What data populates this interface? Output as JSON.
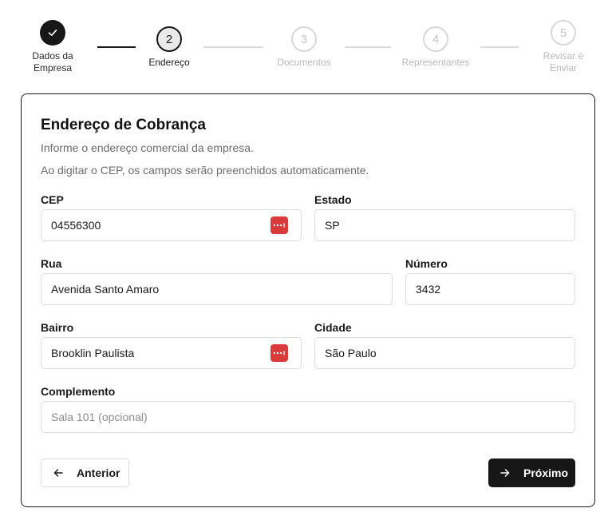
{
  "stepper": {
    "steps": [
      {
        "number": "",
        "label_line1": "Dados da",
        "label_line2": "Empresa",
        "state": "done"
      },
      {
        "number": "2",
        "label_line1": "Endereço",
        "label_line2": "",
        "state": "current"
      },
      {
        "number": "3",
        "label_line1": "Documentos",
        "label_line2": "",
        "state": "todo"
      },
      {
        "number": "4",
        "label_line1": "Representantes",
        "label_line2": "",
        "state": "todo"
      },
      {
        "number": "5",
        "label_line1": "Revisar e",
        "label_line2": "Enviar",
        "state": "todo"
      }
    ]
  },
  "card": {
    "title": "Endereço de Cobrança",
    "subtitle1": "Informe o endereço comercial da empresa.",
    "subtitle2": "Ao digitar o CEP, os campos serão preenchidos automaticamente."
  },
  "fields": {
    "cep": {
      "label": "CEP",
      "value": "04556300"
    },
    "estado": {
      "label": "Estado",
      "value": "SP"
    },
    "rua": {
      "label": "Rua",
      "value": "Avenida Santo Amaro"
    },
    "numero": {
      "label": "Número",
      "value": "3432"
    },
    "bairro": {
      "label": "Bairro",
      "value": "Brooklin Paulista"
    },
    "cidade": {
      "label": "Cidade",
      "value": "São Paulo"
    },
    "complemento": {
      "label": "Complemento",
      "placeholder": "Sala 101 (opcional)"
    }
  },
  "buttons": {
    "prev_label": "Anterior",
    "next_label": "Próximo"
  },
  "colors": {
    "primary": "#171717",
    "password_manager_icon": "#d93a3a",
    "muted_text": "#6b6b6b",
    "border": "#dcdcdc"
  }
}
